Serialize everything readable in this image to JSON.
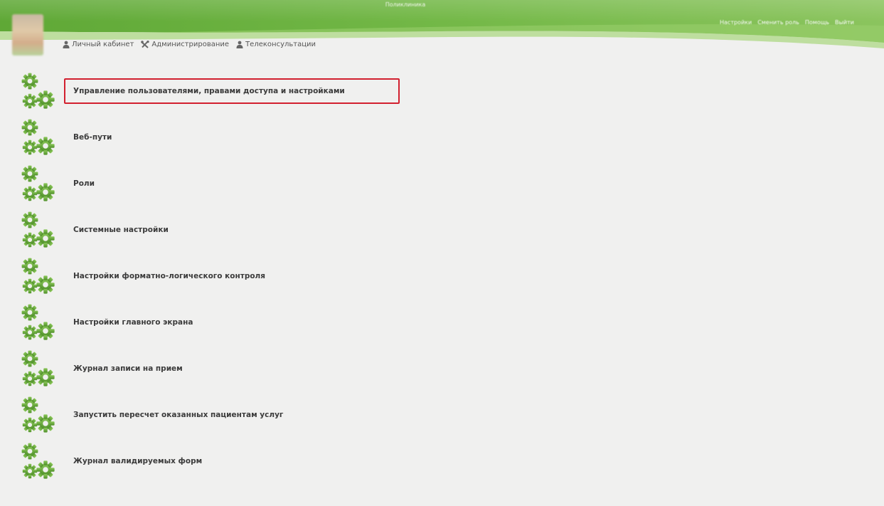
{
  "header": {
    "app_title": "Поликлиника",
    "org_name": "",
    "top_links": [
      "Настройки",
      "Сменить роль",
      "Помощь",
      "Выйти"
    ]
  },
  "menu": [
    {
      "label": "Личный кабинет",
      "icon": "user-icon"
    },
    {
      "label": "Администрирование",
      "icon": "tools-icon"
    },
    {
      "label": "Телеконсультации",
      "icon": "user-icon"
    }
  ],
  "items": [
    {
      "label": "Управление пользователями, правами доступа и настройками",
      "icon": "gears-icon",
      "highlighted": true
    },
    {
      "label": "Веб-пути",
      "icon": "gears-icon"
    },
    {
      "label": "Роли",
      "icon": "gears-icon"
    },
    {
      "label": "Системные настройки",
      "icon": "gears-icon"
    },
    {
      "label": "Настройки форматно-логического контроля",
      "icon": "gears-icon"
    },
    {
      "label": "Настройки главного экрана",
      "icon": "gears-icon"
    },
    {
      "label": "Журнал записи на прием",
      "icon": "gears-icon"
    },
    {
      "label": "Запустить пересчет оказанных пациентам услуг",
      "icon": "gears-icon"
    },
    {
      "label": "Журнал валидируемых форм",
      "icon": "gears-icon"
    }
  ],
  "colors": {
    "header_green": "#6db33f",
    "header_light": "#a7d37d",
    "gear_green": "#6aa83a",
    "highlight_border": "#d2202f",
    "background": "#f0f0ef"
  }
}
